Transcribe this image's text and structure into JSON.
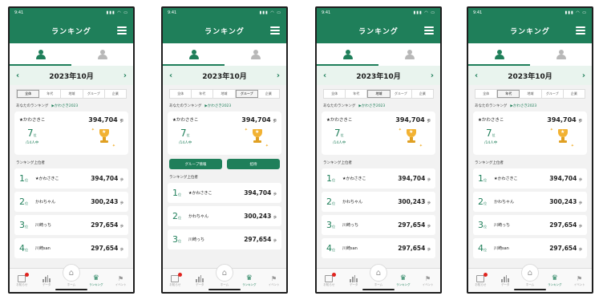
{
  "colors": {
    "accent": "#1f7f5a",
    "trophy": "#f2b233",
    "badge": "#e0231e"
  },
  "status": {
    "time": "9:41",
    "signals": "▮▮▮ ◠ ▭"
  },
  "header": {
    "title": "ランキング"
  },
  "month": {
    "label": "2023年10月",
    "prev": "‹",
    "next": "›"
  },
  "filters": [
    "全体",
    "年代",
    "地域",
    "グループ",
    "企業"
  ],
  "my_ranking": {
    "label": "あなたのランキング",
    "link": "▶かわさき2023"
  },
  "my_card": {
    "name": "★かわさきこ",
    "steps": "394,704",
    "steps_unit": "歩",
    "rank": "7",
    "rank_unit": "位",
    "of": "/14人中"
  },
  "group_buttons": {
    "info": "グループ情報",
    "invite": "招待"
  },
  "top_label": "ランキング上位者",
  "rank_unit": "位",
  "step_unit": "歩",
  "nav": {
    "mail": "お知らせ",
    "data": "データ",
    "home": "ホーム",
    "ranking": "ランキング",
    "event": "イベント"
  },
  "phones": [
    {
      "filter_selected": 0,
      "rows": [
        {
          "pos": "1",
          "name": "★かわさきこ",
          "steps": "394,704"
        },
        {
          "pos": "2",
          "name": "かわちゃん",
          "steps": "300,243"
        },
        {
          "pos": "3",
          "name": "川崎っち",
          "steps": "297,654"
        },
        {
          "pos": "4",
          "name": "川崎san",
          "steps": "297,654"
        }
      ]
    },
    {
      "filter_selected": 3,
      "rows": [
        {
          "pos": "1",
          "name": "★かわさきこ",
          "steps": "394,704"
        },
        {
          "pos": "2",
          "name": "かわちゃん",
          "steps": "300,243"
        },
        {
          "pos": "3",
          "name": "川崎っち",
          "steps": "297,654"
        }
      ]
    },
    {
      "filter_selected": 2,
      "rows": [
        {
          "pos": "1",
          "name": "★かわさきこ",
          "steps": "394,704"
        },
        {
          "pos": "2",
          "name": "かわちゃん",
          "steps": "300,243"
        },
        {
          "pos": "3",
          "name": "川崎っち",
          "steps": "297,654"
        },
        {
          "pos": "4",
          "name": "川崎san",
          "steps": "297,654"
        }
      ]
    },
    {
      "filter_selected": 1,
      "rows": [
        {
          "pos": "1",
          "name": "★かわさきこ",
          "steps": "394,704"
        },
        {
          "pos": "2",
          "name": "かわちゃん",
          "steps": "300,243"
        },
        {
          "pos": "3",
          "name": "川崎っち",
          "steps": "297,654"
        },
        {
          "pos": "4",
          "name": "川崎san",
          "steps": "297,654"
        }
      ]
    }
  ]
}
